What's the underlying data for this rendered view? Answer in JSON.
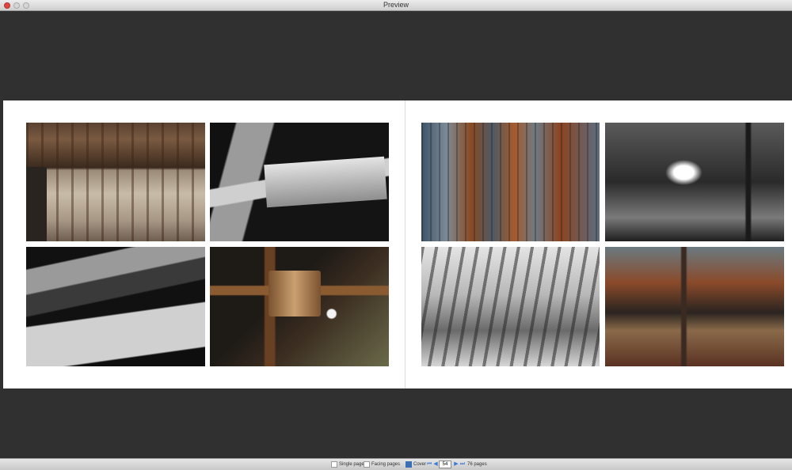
{
  "window": {
    "title": "Preview"
  },
  "book": {
    "left_page": [
      {
        "name": "weathered-wood-planks"
      },
      {
        "name": "wooden-beam-closeup"
      },
      {
        "name": "bolted-wood-board"
      },
      {
        "name": "rafter-and-hook"
      }
    ],
    "right_page": [
      {
        "name": "rusted-corrugated-metal"
      },
      {
        "name": "peeling-paint-panel"
      },
      {
        "name": "white-grunge-texture"
      },
      {
        "name": "rusted-metal-wall"
      }
    ]
  },
  "bottom_bar": {
    "single_page_label": "Single page",
    "facing_pages_label": "Facing pages",
    "cover_label": "Cover",
    "current_page": "54",
    "total_pages": "76 pages"
  },
  "colors": {
    "accent": "#3b7bd6",
    "background": "#2f2f2f",
    "page": "#ffffff"
  },
  "icons": [
    "close-icon",
    "minimize-icon",
    "zoom-icon",
    "cover-icon",
    "first-page-icon",
    "prev-page-icon",
    "next-page-icon",
    "last-page-icon"
  ]
}
